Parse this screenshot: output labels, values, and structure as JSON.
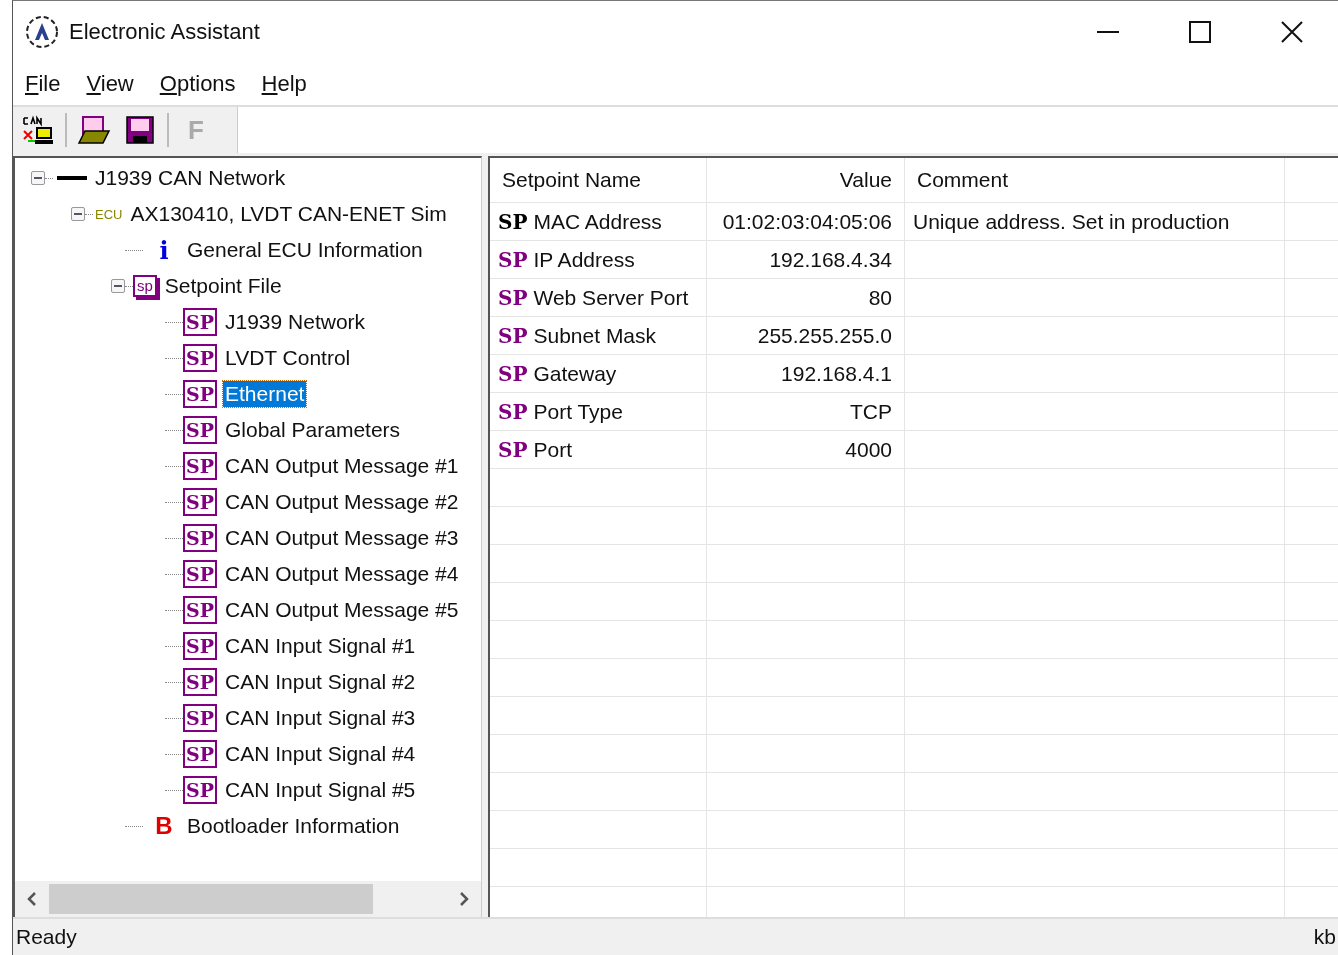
{
  "window": {
    "title": "Electronic Assistant"
  },
  "menu": [
    {
      "label": "File"
    },
    {
      "label": "View"
    },
    {
      "label": "Options"
    },
    {
      "label": "Help"
    }
  ],
  "toolbar": [
    {
      "kind": "can"
    },
    {
      "kind": "open"
    },
    {
      "kind": "save"
    },
    {
      "kind": "letter",
      "label": "F",
      "disabled": true
    }
  ],
  "tree": [
    {
      "kind": "network",
      "label": "J1939 CAN Network",
      "expanded": true,
      "selected": false,
      "children": [
        {
          "kind": "ecu",
          "badge": "ECU",
          "label": "AX130410, LVDT CAN-ENET Sim",
          "expanded": true,
          "selected": false,
          "children": [
            {
              "kind": "info",
              "glyph": "i",
              "label": "General ECU Information",
              "selected": false
            },
            {
              "kind": "setpoint_file",
              "icon": "sp",
              "label": "Setpoint File",
              "expanded": true,
              "selected": false,
              "children": [
                {
                  "kind": "setpoint",
                  "icon": "SP",
                  "label": "J1939 Network",
                  "selected": false
                },
                {
                  "kind": "setpoint",
                  "icon": "SP",
                  "label": "LVDT Control",
                  "selected": false
                },
                {
                  "kind": "setpoint",
                  "icon": "SP",
                  "label": "Ethernet",
                  "selected": true
                },
                {
                  "kind": "setpoint",
                  "icon": "SP",
                  "label": "Global Parameters",
                  "selected": false
                },
                {
                  "kind": "setpoint",
                  "icon": "SP",
                  "label": "CAN Output Message #1",
                  "selected": false
                },
                {
                  "kind": "setpoint",
                  "icon": "SP",
                  "label": "CAN Output Message #2",
                  "selected": false
                },
                {
                  "kind": "setpoint",
                  "icon": "SP",
                  "label": "CAN Output Message #3",
                  "selected": false
                },
                {
                  "kind": "setpoint",
                  "icon": "SP",
                  "label": "CAN Output Message #4",
                  "selected": false
                },
                {
                  "kind": "setpoint",
                  "icon": "SP",
                  "label": "CAN Output Message #5",
                  "selected": false
                },
                {
                  "kind": "setpoint",
                  "icon": "SP",
                  "label": "CAN Input Signal #1",
                  "selected": false
                },
                {
                  "kind": "setpoint",
                  "icon": "SP",
                  "label": "CAN Input Signal #2",
                  "selected": false
                },
                {
                  "kind": "setpoint",
                  "icon": "SP",
                  "label": "CAN Input Signal #3",
                  "selected": false
                },
                {
                  "kind": "setpoint",
                  "icon": "SP",
                  "label": "CAN Input Signal #4",
                  "selected": false
                },
                {
                  "kind": "setpoint",
                  "icon": "SP",
                  "label": "CAN Input Signal #5",
                  "selected": false
                }
              ]
            },
            {
              "kind": "bootloader",
              "glyph": "B",
              "label": "Bootloader Information",
              "selected": false
            }
          ]
        }
      ]
    }
  ],
  "table": {
    "columns": [
      "Setpoint Name",
      "Value",
      "Comment"
    ],
    "rows": [
      {
        "mark": "SP",
        "color": "#000000",
        "name": "MAC Address",
        "value": "01:02:03:04:05:06",
        "comment": "Unique address. Set in production"
      },
      {
        "mark": "SP",
        "color": "#800080",
        "name": "IP Address",
        "value": "192.168.4.34"
      },
      {
        "mark": "SP",
        "color": "#800080",
        "name": "Web Server Port",
        "value": "80"
      },
      {
        "mark": "SP",
        "color": "#800080",
        "name": "Subnet Mask",
        "value": "255.255.255.0"
      },
      {
        "mark": "SP",
        "color": "#800080",
        "name": "Gateway",
        "value": "192.168.4.1"
      },
      {
        "mark": "SP",
        "color": "#800080",
        "name": "Port Type",
        "value": "TCP"
      },
      {
        "mark": "SP",
        "color": "#800080",
        "name": "Port",
        "value": "4000"
      }
    ]
  },
  "status_bar": {
    "text": "Ready",
    "right": "kb"
  }
}
